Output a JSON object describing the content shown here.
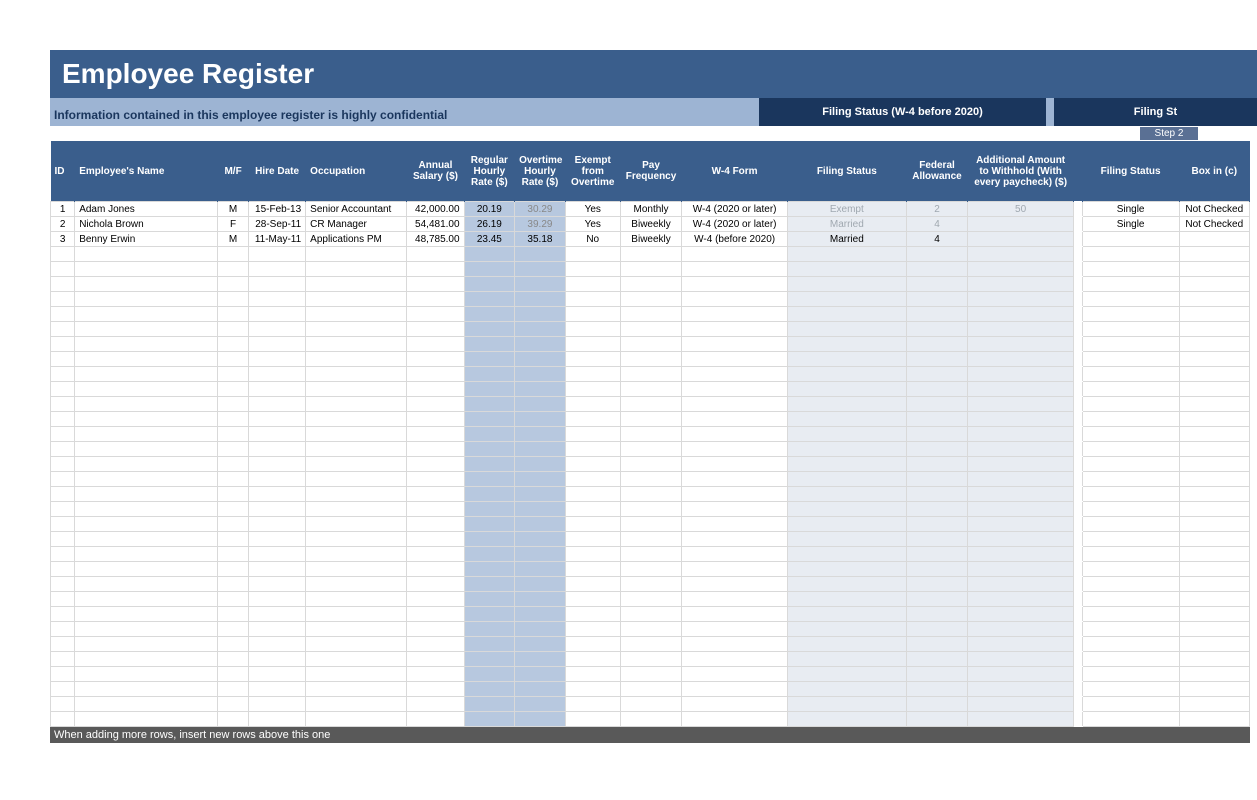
{
  "title": "Employee Register",
  "subtitle": "Information contained in this employee register is highly confidential",
  "band_a": "Filing Status (W-4 before 2020)",
  "band_b": "Filing St",
  "step2": "Step 2",
  "headers": {
    "id": "ID",
    "name": "Employee's Name",
    "mf": "M/F",
    "hire": "Hire Date",
    "occ": "Occupation",
    "sal": "Annual Salary ($)",
    "reg": "Regular Hourly Rate ($)",
    "ot": "Overtime Hourly Rate ($)",
    "ex": "Exempt from Overtime",
    "pay": "Pay Frequency",
    "w4": "W-4 Form",
    "fs": "Filing Status",
    "fa": "Federal Allowance",
    "add": "Additional Amount to Withhold (With every paycheck) ($)",
    "fs2": "Filing Status",
    "box": "Box in (c)"
  },
  "rows": [
    {
      "id": "1",
      "name": "Adam Jones",
      "mf": "M",
      "hire": "15-Feb-13",
      "occ": "Senior Accountant",
      "sal": "42,000.00",
      "reg": "20.19",
      "ot": "30.29",
      "ot_dim": true,
      "ex": "Yes",
      "pay": "Monthly",
      "w4": "W-4 (2020 or later)",
      "fs": "Exempt",
      "fs_dim": true,
      "fa": "2",
      "fa_dim": true,
      "add": "50",
      "add_dim": true,
      "fs2": "Single",
      "box": "Not Checked"
    },
    {
      "id": "2",
      "name": "Nichola Brown",
      "mf": "F",
      "hire": "28-Sep-11",
      "occ": "CR Manager",
      "sal": "54,481.00",
      "reg": "26.19",
      "ot": "39.29",
      "ot_dim": true,
      "ex": "Yes",
      "pay": "Biweekly",
      "w4": "W-4 (2020 or later)",
      "fs": "Married",
      "fs_dim": true,
      "fa": "4",
      "fa_dim": true,
      "add": "",
      "add_dim": true,
      "fs2": "Single",
      "box": "Not Checked"
    },
    {
      "id": "3",
      "name": "Benny Erwin",
      "mf": "M",
      "hire": "11-May-11",
      "occ": "Applications PM",
      "sal": "48,785.00",
      "reg": "23.45",
      "ot": "35.18",
      "ot_dim": false,
      "ex": "No",
      "pay": "Biweekly",
      "w4": "W-4 (before 2020)",
      "fs": "Married",
      "fs_dim": false,
      "fa": "4",
      "fa_dim": false,
      "add": "",
      "add_dim": false,
      "fs2": "",
      "box": ""
    }
  ],
  "empty_row_count": 32,
  "footer": "When adding more rows, insert new rows above this one"
}
